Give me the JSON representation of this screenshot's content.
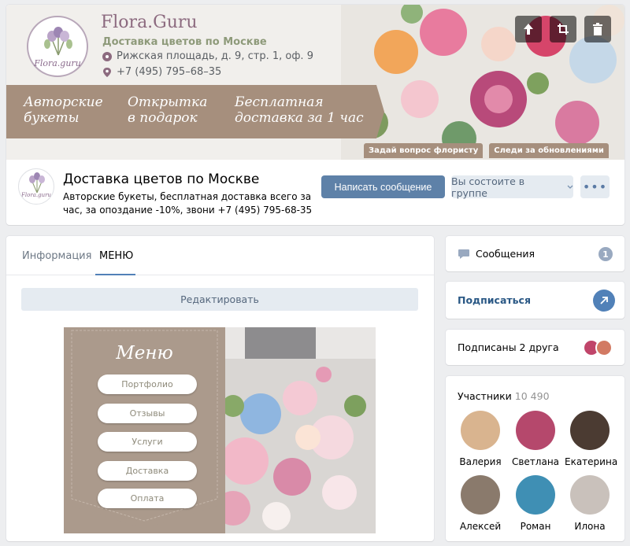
{
  "cover": {
    "brand": "Flora.Guru",
    "brand_sub": "Доставка цветов по Москве",
    "logo_text": "Flora.guru",
    "address": "Рижская площадь, д. 9, стр. 1, оф. 9",
    "phone": "+7 (495) 795–68–35",
    "banner": [
      {
        "line1": "Авторские",
        "line2": "букеты"
      },
      {
        "line1": "Открытка",
        "line2": "в подарок"
      },
      {
        "line1": "Бесплатная",
        "line2": "доставка за 1 час"
      }
    ],
    "links": [
      "Задай вопрос флористу",
      "Следи за обновлениями"
    ],
    "controls": [
      "upload-icon",
      "crop-icon",
      "trash-icon"
    ]
  },
  "group": {
    "name": "Доставка цветов по Москве",
    "status": "Авторские букеты, бесплатная доставка всего за час, за опоздание -10%, звони +7 (495) 795-68-35",
    "message_button": "Написать сообщение",
    "member_button": "Вы состоите в группе",
    "more_button": "•••"
  },
  "main": {
    "tabs": [
      {
        "label": "Информация",
        "active": false
      },
      {
        "label": "МЕНЮ",
        "active": true
      }
    ],
    "edit_button": "Редактировать",
    "menu": {
      "title": "Меню",
      "items": [
        "Портфолио",
        "Отзывы",
        "Услуги",
        "Доставка",
        "Оплата"
      ]
    }
  },
  "sidebar": {
    "messages": {
      "label": "Сообщения",
      "count": "1"
    },
    "subscribe": {
      "label": "Подписаться"
    },
    "friends": {
      "label": "Подписаны 2 друга"
    },
    "members": {
      "title": "Участники",
      "count": "10 490",
      "people": [
        {
          "name": "Валерия",
          "color": "#d9b48f"
        },
        {
          "name": "Светлана",
          "color": "#b5486c"
        },
        {
          "name": "Екатерина",
          "color": "#4b3b32"
        },
        {
          "name": "Алексей",
          "color": "#8a7a6c"
        },
        {
          "name": "Роман",
          "color": "#3f8fb4"
        },
        {
          "name": "Илона",
          "color": "#c9c1bb"
        }
      ]
    }
  },
  "colors": {
    "accent": "#5181b8",
    "button_primary": "#5e81a8",
    "banner": "#a68f7d",
    "menu_panel": "#ab9a8c"
  }
}
